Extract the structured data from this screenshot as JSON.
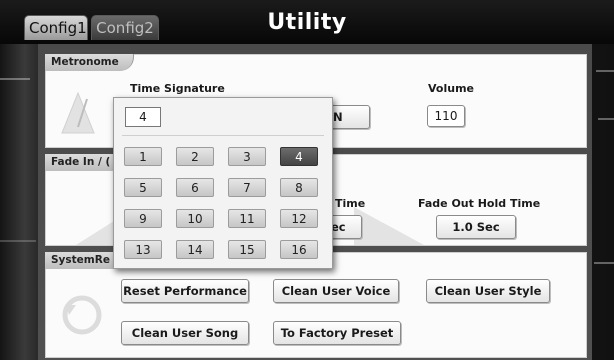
{
  "header": {
    "tabs": [
      {
        "label": "Config1",
        "active": true
      },
      {
        "label": "Config2",
        "active": false
      }
    ],
    "title": "Utility"
  },
  "metronome": {
    "section_label": "Metronome",
    "time_signature_label": "Time Signature",
    "time_signature_value": "4",
    "partial_button_text": "N",
    "volume_label": "Volume",
    "volume_value": "110"
  },
  "fade": {
    "section_label": "Fade In / (",
    "partial_time_label": "Time",
    "partial_time_value": "ec",
    "fade_out_hold_label": "Fade Out Hold Time",
    "fade_out_hold_value": "1.0 Sec"
  },
  "system_reset": {
    "section_label": "SystemRe",
    "buttons": {
      "reset_performance": "Reset Performance",
      "clean_user_voice": "Clean User Voice",
      "clean_user_style": "Clean User Style",
      "clean_user_song": "Clean User Song",
      "to_factory_preset": "To Factory Preset"
    }
  },
  "popup": {
    "current_value": "4",
    "selected": "4",
    "keys": [
      "1",
      "2",
      "3",
      "4",
      "5",
      "6",
      "7",
      "8",
      "9",
      "10",
      "11",
      "12",
      "13",
      "14",
      "15",
      "16"
    ]
  },
  "colors": {
    "selected_key": "#4f4f4f",
    "panel": "#4c4c4c"
  }
}
